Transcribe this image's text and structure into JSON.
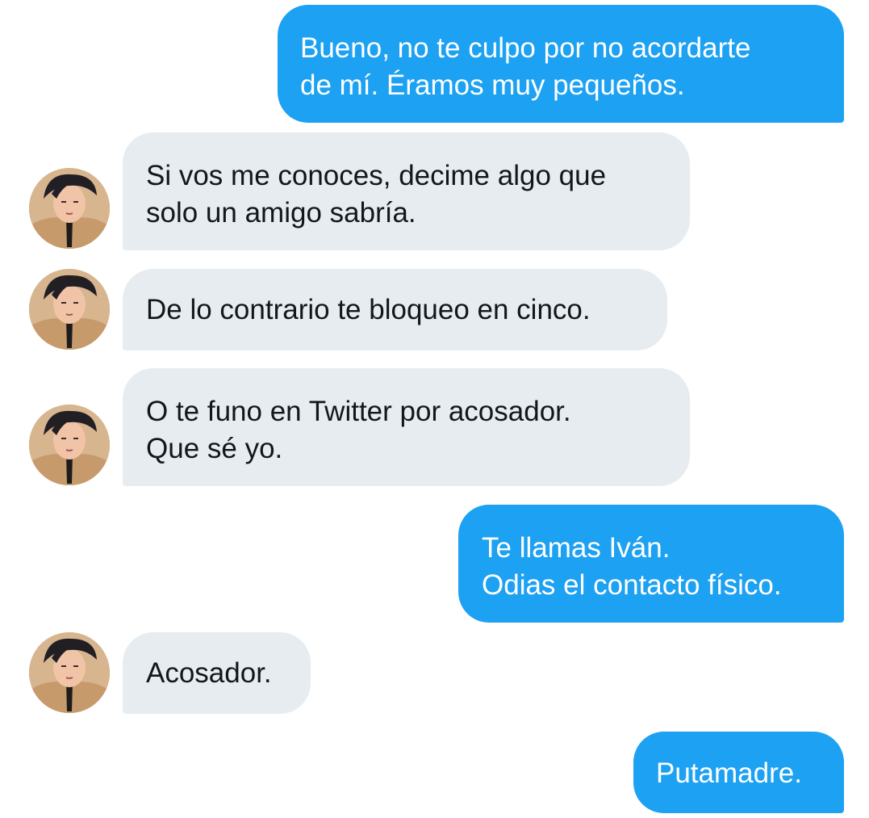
{
  "conversation": {
    "messages": [
      {
        "direction": "sent",
        "text": "Bueno, no te culpo por no acordarte\nde mí. Éramos muy pequeños."
      },
      {
        "direction": "received",
        "text": "Si vos me conoces, decime algo que\nsolo un amigo sabría.",
        "avatar": "contact-avatar"
      },
      {
        "direction": "received",
        "text": "De lo contrario te bloqueo en cinco.",
        "avatar": "contact-avatar"
      },
      {
        "direction": "received",
        "text": "O te funo en Twitter por acosador.\nQue sé yo.",
        "avatar": "contact-avatar"
      },
      {
        "direction": "sent",
        "text": "Te llamas Iván.\nOdias el contacto físico."
      },
      {
        "direction": "received",
        "text": "Acosador.",
        "avatar": "contact-avatar"
      },
      {
        "direction": "sent",
        "text": "Putamadre."
      }
    ]
  },
  "colors": {
    "sent_bubble": "#1da1f2",
    "sent_text": "#ffffff",
    "received_bubble": "#e6ecf0",
    "received_text": "#14171a",
    "background": "#ffffff"
  }
}
